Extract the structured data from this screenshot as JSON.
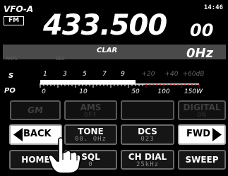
{
  "status": {
    "vfo_label": "VFO-A",
    "mode": "FM",
    "clock": "14:46"
  },
  "frequency": {
    "main": "433.500",
    "small": "00"
  },
  "clar_bar": {
    "amp_label": "AMP1",
    "dec_label": "DEC",
    "clar_label": "CLAR",
    "clar_value": "0Hz"
  },
  "meter": {
    "s_label": "S",
    "po_label": "PO",
    "s_scale": [
      "1",
      "3",
      "5",
      "7",
      "9",
      "+20",
      "+40",
      "+60dB"
    ],
    "po_scale": [
      "0",
      "10",
      "50",
      "100",
      "150W"
    ],
    "level_fraction": 0.6
  },
  "buttons": {
    "row1": [
      {
        "label": "GM",
        "sub": ""
      },
      {
        "label": "AMS",
        "sub": "OFF"
      },
      {
        "label": "",
        "sub": ""
      },
      {
        "label": "DIGITAL",
        "sub": "ON"
      }
    ],
    "row2": [
      {
        "label": "BACK",
        "sub": ""
      },
      {
        "label": "TONE",
        "sub": "00. 0Hz"
      },
      {
        "label": "DCS",
        "sub": "023"
      },
      {
        "label": "FWD",
        "sub": ""
      }
    ],
    "row3": [
      {
        "label": "HOME",
        "sub": ""
      },
      {
        "label": "SQL",
        "sub": "0"
      },
      {
        "label": "CH DIAL",
        "sub": "25kHz"
      },
      {
        "label": "SWEEP",
        "sub": ""
      }
    ]
  },
  "colors": {
    "background": "#000000",
    "clar_band": "#4a4a4a",
    "accent_red": "#d00000",
    "dim_scale": "#666666"
  }
}
